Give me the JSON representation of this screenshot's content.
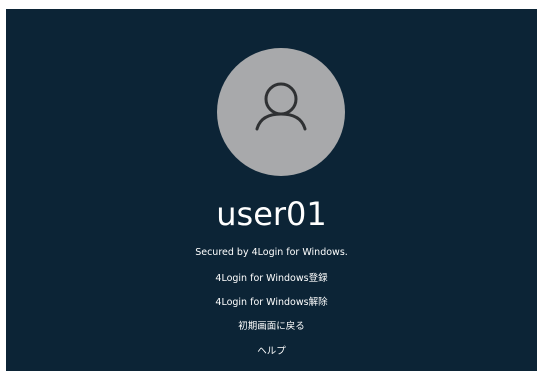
{
  "user": {
    "name": "user01"
  },
  "security_notice": "Secured by 4Login for  Windows.",
  "links": [
    {
      "label": "4Login for Windows登録"
    },
    {
      "label": "4Login for Windows解除"
    },
    {
      "label": "初期画面に戻る"
    },
    {
      "label": "ヘルプ"
    }
  ],
  "colors": {
    "background": "#0c2436",
    "avatar_circle": "#a8a9ab",
    "avatar_glyph": "#2f3133",
    "text": "#ffffff"
  },
  "icons": {
    "avatar": "user-icon"
  }
}
